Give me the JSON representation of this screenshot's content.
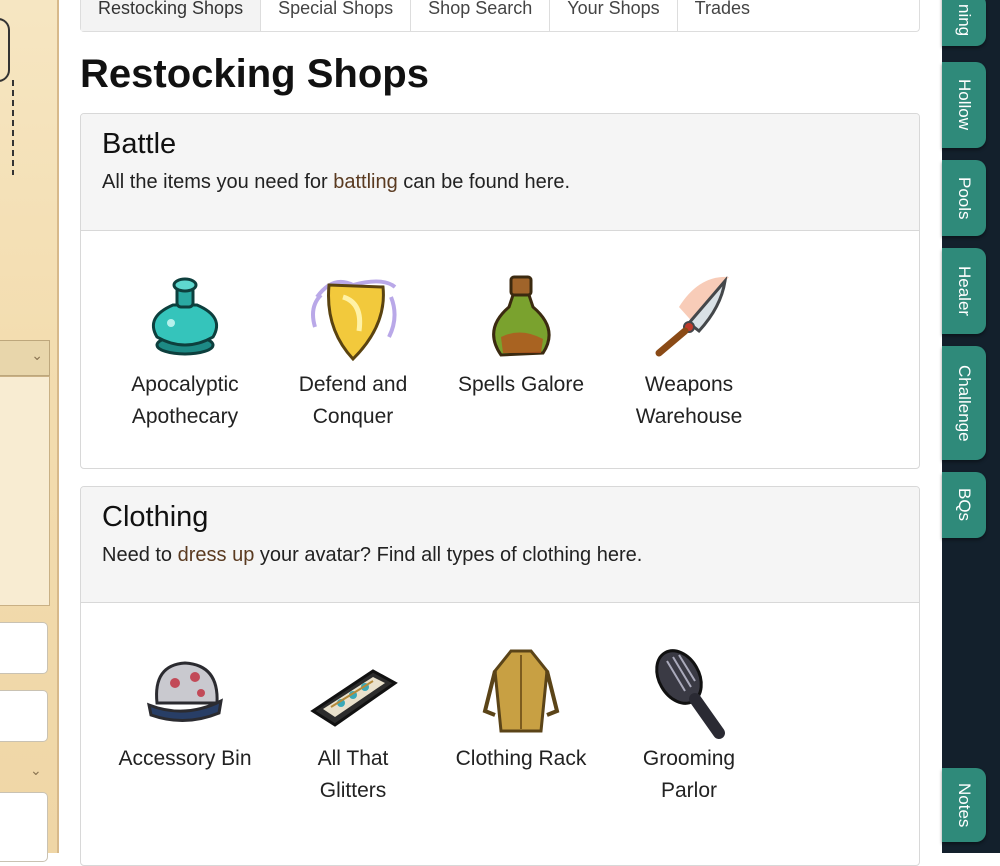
{
  "tabs": [
    "Restocking Shops",
    "Special Shops",
    "Shop Search",
    "Your Shops",
    "Trades"
  ],
  "active_tab": "Restocking Shops",
  "page_title": "Restocking Shops",
  "sections": [
    {
      "title": "Battle",
      "desc_pre": "All the items you need for ",
      "desc_link": "battling",
      "desc_post": " can be found here.",
      "shops": [
        {
          "label_lines": [
            "Apocalyptic",
            "Apothecary"
          ],
          "icon": "teal-potion-icon"
        },
        {
          "label_lines": [
            "Defend and",
            "Conquer"
          ],
          "icon": "golden-shield-icon"
        },
        {
          "label_lines": [
            "Spells Galore",
            ""
          ],
          "icon": "green-elixir-icon"
        },
        {
          "label_lines": [
            "Weapons",
            "Warehouse"
          ],
          "icon": "flaming-blade-icon"
        }
      ]
    },
    {
      "title": "Clothing",
      "desc_pre": "Need to ",
      "desc_link": "dress up",
      "desc_post": " your avatar? Find all types of clothing here.",
      "shops": [
        {
          "label_lines": [
            "Accessory Bin",
            ""
          ],
          "icon": "cap-icon"
        },
        {
          "label_lines": [
            "All That",
            "Glitters"
          ],
          "icon": "jewelry-box-icon"
        },
        {
          "label_lines": [
            "Clothing Rack",
            ""
          ],
          "icon": "coat-icon"
        },
        {
          "label_lines": [
            "Grooming",
            "Parlor"
          ],
          "icon": "hairbrush-icon"
        }
      ]
    }
  ],
  "side_nav": [
    "ning",
    "Hollow",
    "Pools",
    "Healer",
    "Challenge",
    "BQs",
    "Notes"
  ],
  "colors": {
    "side_tab": "#2f8a7a",
    "rail": "#13202c",
    "link": "#5a3a20"
  }
}
